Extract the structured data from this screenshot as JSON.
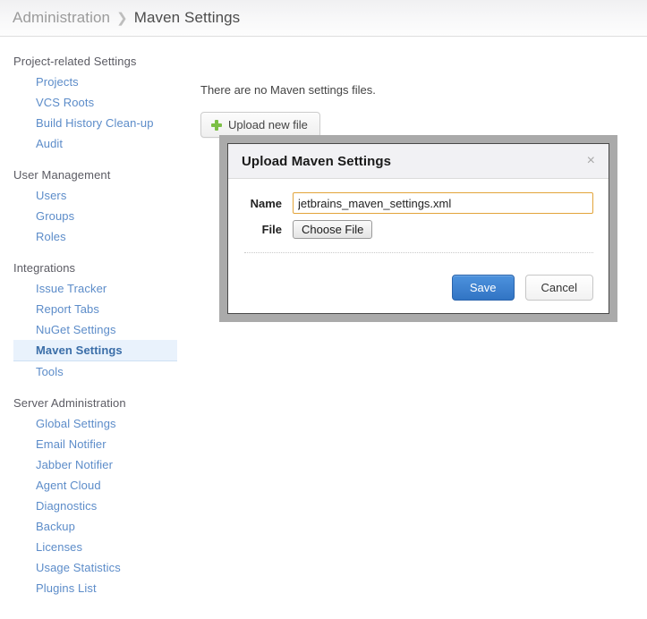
{
  "header": {
    "breadcrumb_root": "Administration",
    "breadcrumb_separator": "❯",
    "breadcrumb_current": "Maven Settings"
  },
  "sidebar": {
    "groups": [
      {
        "title": "Project-related Settings",
        "items": [
          {
            "label": "Projects",
            "selected": false
          },
          {
            "label": "VCS Roots",
            "selected": false
          },
          {
            "label": "Build History Clean-up",
            "selected": false
          },
          {
            "label": "Audit",
            "selected": false
          }
        ]
      },
      {
        "title": "User Management",
        "items": [
          {
            "label": "Users",
            "selected": false
          },
          {
            "label": "Groups",
            "selected": false
          },
          {
            "label": "Roles",
            "selected": false
          }
        ]
      },
      {
        "title": "Integrations",
        "items": [
          {
            "label": "Issue Tracker",
            "selected": false
          },
          {
            "label": "Report Tabs",
            "selected": false
          },
          {
            "label": "NuGet Settings",
            "selected": false
          },
          {
            "label": "Maven Settings",
            "selected": true
          },
          {
            "label": "Tools",
            "selected": false
          }
        ]
      },
      {
        "title": "Server Administration",
        "items": [
          {
            "label": "Global Settings",
            "selected": false
          },
          {
            "label": "Email Notifier",
            "selected": false
          },
          {
            "label": "Jabber Notifier",
            "selected": false
          },
          {
            "label": "Agent Cloud",
            "selected": false
          },
          {
            "label": "Diagnostics",
            "selected": false
          },
          {
            "label": "Backup",
            "selected": false
          },
          {
            "label": "Licenses",
            "selected": false
          },
          {
            "label": "Usage Statistics",
            "selected": false
          },
          {
            "label": "Plugins List",
            "selected": false
          }
        ]
      }
    ]
  },
  "main": {
    "empty_message": "There are no Maven settings files.",
    "upload_button_label": "Upload new file",
    "upload_button_icon": "plus-icon"
  },
  "modal": {
    "title": "Upload Maven Settings",
    "close_icon": "×",
    "name_label": "Name",
    "name_value": "jetbrains_maven_settings.xml",
    "name_placeholder": "",
    "file_label": "File",
    "choose_file_label": "Choose File",
    "save_label": "Save",
    "cancel_label": "Cancel"
  },
  "colors": {
    "link": "#5c8cc9",
    "selected_bg": "#e9f2fc",
    "accent_focus_border": "#e2a43a",
    "primary_button": "#3174c4",
    "plus_green": "#7cbf45",
    "modal_frame": "#aaaaaa"
  }
}
